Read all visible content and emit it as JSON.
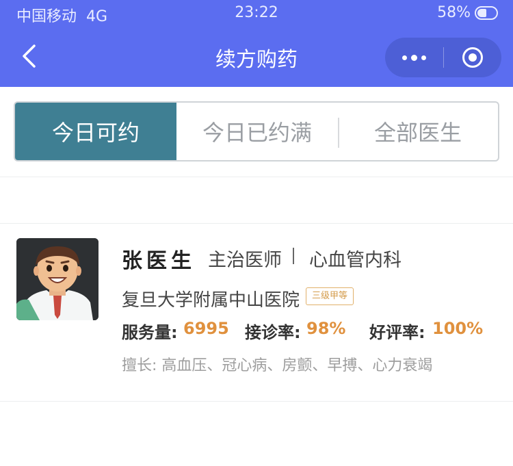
{
  "status_bar": {
    "carrier": "中国移动",
    "network": "4G",
    "time": "23:22",
    "battery": "58%"
  },
  "nav": {
    "title": "续方购药",
    "icons": [
      "back-chevron-icon",
      "more-dots-icon",
      "close-target-icon"
    ]
  },
  "tabs": [
    {
      "label": "今日可约",
      "active": true
    },
    {
      "label": "今日已约满",
      "active": false
    },
    {
      "label": "全部医生",
      "active": false
    }
  ],
  "doctor": {
    "name": "张医生",
    "title": "主治医师",
    "department": "心血管内科",
    "hospital": "复旦大学附属中山医院",
    "hospital_level": "三级甲等",
    "stats": [
      {
        "label": "服务量:",
        "value": "6995"
      },
      {
        "label": "接诊率:",
        "value": "98%"
      },
      {
        "label": "好评率:",
        "value": "100%"
      }
    ],
    "specialty": "擅长: 高血压、冠心病、房颤、早搏、心力衰竭",
    "avatar": "doctor-cartoon-avatar"
  },
  "colors": {
    "header_bg": "#5b6df0",
    "active_tab": "#3f7f93",
    "stat_value": "#e0913e",
    "badge": "#d49b4a"
  }
}
